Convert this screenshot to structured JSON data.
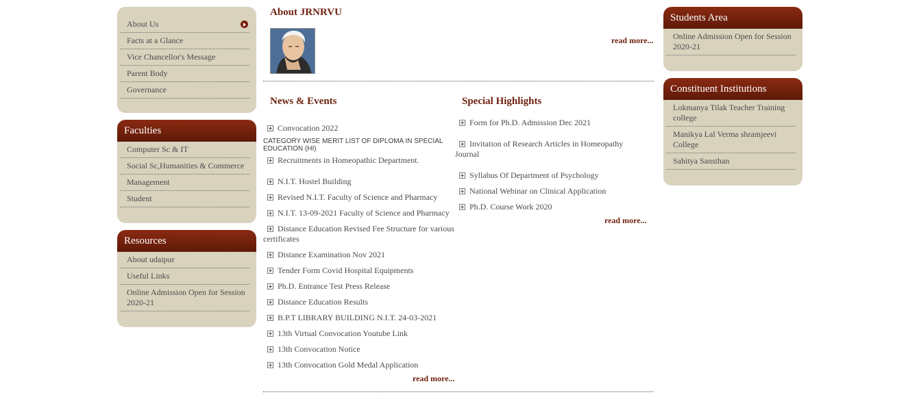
{
  "left_sidebar": {
    "about": {
      "items": [
        "About Us",
        "Facts at a Glance",
        "Vice Chancellor's Message",
        "Parent Body",
        "Governance"
      ]
    },
    "faculties": {
      "title": "Faculties",
      "items": [
        "Computer Sc & IT",
        "Social Sc,Humanities & Commerce",
        "Management",
        "Student"
      ]
    },
    "resources": {
      "title": "Resources",
      "items": [
        "About udaipur",
        "Useful Links",
        "Online Admission Open for Session 2020-21"
      ]
    }
  },
  "about_section": {
    "title": "About JRNRVU",
    "read_more": "read more..."
  },
  "news_events": {
    "title": "News & Events",
    "items": [
      "Convocation 2022",
      "CATEGORY WISE MERIT LIST OF DIPLOMA IN SPECIAL EDUCATION (HI)",
      "Recruitments in Homeopathic Department.",
      "N.I.T. Hostel Building",
      "Revised N.I.T. Faculty of Science and Pharmacy",
      "N.I.T. 13-09-2021 Faculty of Science and Pharmacy",
      "Distance Education Revised Fee Structure for various certificates",
      "Distance Examination Nov 2021",
      "Tender Form Covid Hospital Equipments",
      "Ph.D. Entrance Test Press Release",
      "Distance Education Results",
      "B.P.T LIBRARY BUILDING N.I.T. 24-03-2021",
      "13th Virtual Convocation Youtube Link",
      "13th Convocation Notice",
      "13th Convocation Gold Medal Application"
    ],
    "read_more": "read more..."
  },
  "special_highlights": {
    "title": "Special Highlights",
    "items": [
      "Form for Ph.D. Admission Dec 2021",
      "Invitation of Research Articles in Homeopathy Journal",
      "Syllabus Of Department of Psychology",
      "National Webinar on Clinical Application",
      "Ph.D. Course Work 2020"
    ],
    "read_more": "read more..."
  },
  "right_sidebar": {
    "students_area": {
      "title": "Students Area",
      "items": [
        "Online Admission Open for Session 2020-21"
      ]
    },
    "constituent": {
      "title": "Constituent Institutions",
      "items": [
        "Lokmanya Tilak Teacher Training college",
        "Manikya Lal Verma shramjeevi College",
        "Sahitya Sansthan"
      ]
    }
  },
  "icons": {
    "list_bullet": "plus-box-icon",
    "active_arrow": "arrow-right-circle-icon"
  },
  "colors": {
    "header_maroon": "#6e2210",
    "box_beige": "#d9d2bd"
  }
}
